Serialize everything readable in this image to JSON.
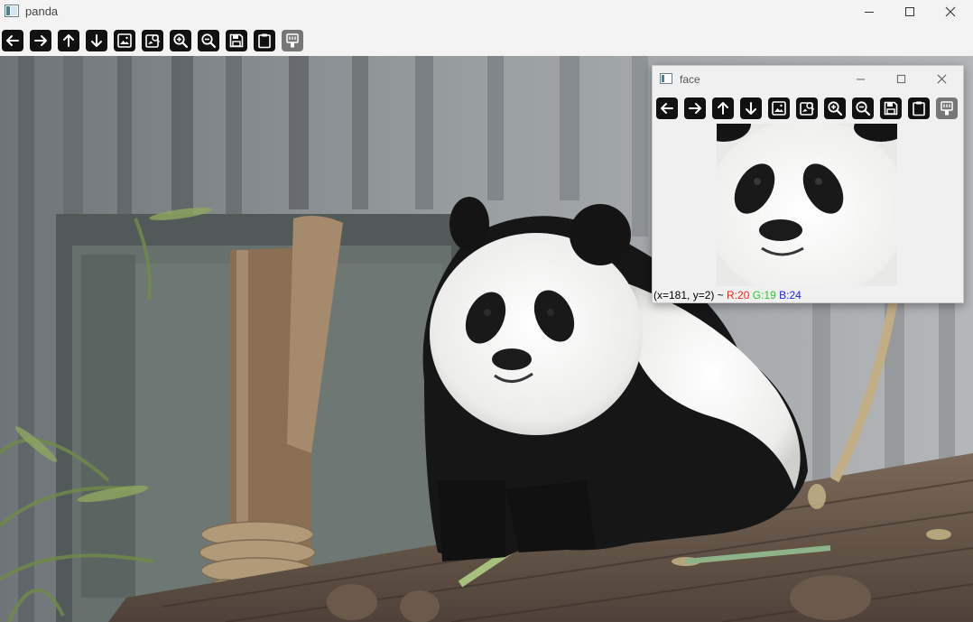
{
  "main_window": {
    "title": "panda",
    "toolbar": [
      {
        "name": "pan-left-button",
        "icon": "arrow-left-icon"
      },
      {
        "name": "pan-right-button",
        "icon": "arrow-right-icon"
      },
      {
        "name": "pan-up-button",
        "icon": "arrow-up-icon"
      },
      {
        "name": "pan-down-button",
        "icon": "arrow-down-icon"
      },
      {
        "name": "zoom-fit-button",
        "icon": "image-icon"
      },
      {
        "name": "zoom-original-button",
        "icon": "image-zoom-icon"
      },
      {
        "name": "zoom-in-button",
        "icon": "zoom-in-icon"
      },
      {
        "name": "zoom-out-button",
        "icon": "zoom-out-icon"
      },
      {
        "name": "save-button",
        "icon": "save-icon"
      },
      {
        "name": "copy-clipboard-button",
        "icon": "clipboard-icon"
      },
      {
        "name": "properties-button",
        "icon": "properties-icon"
      }
    ]
  },
  "child_window": {
    "title": "face",
    "status": {
      "coords": "(x=181, y=2) ~ ",
      "r": "R:20",
      "g": "G:19",
      "b": "B:24"
    }
  },
  "colors": {
    "toolbar_button": "#111111",
    "toolbar_button_disabled": "#777777",
    "status_r": "#ff2020",
    "status_g": "#22cc22",
    "status_b": "#2020ff"
  }
}
